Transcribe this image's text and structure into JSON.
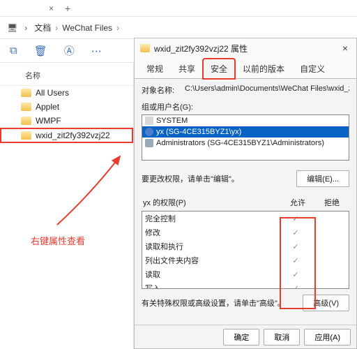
{
  "tabs": {
    "close_glyph": "×",
    "new_glyph": "+"
  },
  "nav": {
    "pc_glyph": "🖥",
    "sep": "›",
    "crumbs": [
      "文档",
      "WeChat Files"
    ],
    "chev": "›"
  },
  "toolbar": {
    "icons": [
      "⧉",
      "🗑",
      "Ⓐ",
      "⋯"
    ]
  },
  "column_header": "名称",
  "folders": [
    {
      "name": "All Users"
    },
    {
      "name": "Applet"
    },
    {
      "name": "WMPF"
    },
    {
      "name": "wxid_zit2fy392vzj22",
      "highlight": true
    }
  ],
  "annotation": "右键属性查看",
  "dialog": {
    "title": "wxid_zit2fy392vzj22 属性",
    "close": "×",
    "tabs": [
      "常规",
      "共享",
      "安全",
      "以前的版本",
      "自定义"
    ],
    "active_tab_index": 2,
    "object": {
      "label": "对象名称:",
      "value": "C:\\Users\\admin\\Documents\\WeChat Files\\wxid_zi"
    },
    "groups_label": "组或用户名(G):",
    "groups": [
      {
        "icon": "sys",
        "text": "SYSTEM"
      },
      {
        "icon": "user",
        "text": "yx (SG-4CE315BYZ1\\yx)",
        "selected": true
      },
      {
        "icon": "grp",
        "text": "Administrators (SG-4CE315BYZ1\\Administrators)"
      }
    ],
    "edit_hint": "要更改权限，请单击\"编辑\"。",
    "edit_btn": "编辑(E)...",
    "perm_label_prefix": "yx 的权限(P)",
    "allow": "允许",
    "deny": "拒绝",
    "permissions": [
      {
        "name": "完全控制",
        "allow": true
      },
      {
        "name": "修改",
        "allow": true
      },
      {
        "name": "读取和执行",
        "allow": true
      },
      {
        "name": "列出文件夹内容",
        "allow": true
      },
      {
        "name": "读取",
        "allow": true
      },
      {
        "name": "写入",
        "allow": true
      }
    ],
    "adv_hint": "有关特殊权限或高级设置，请单击\"高级\"。",
    "adv_btn": "高级(V)",
    "ok": "确定",
    "cancel": "取消",
    "apply": "应用(A)"
  }
}
